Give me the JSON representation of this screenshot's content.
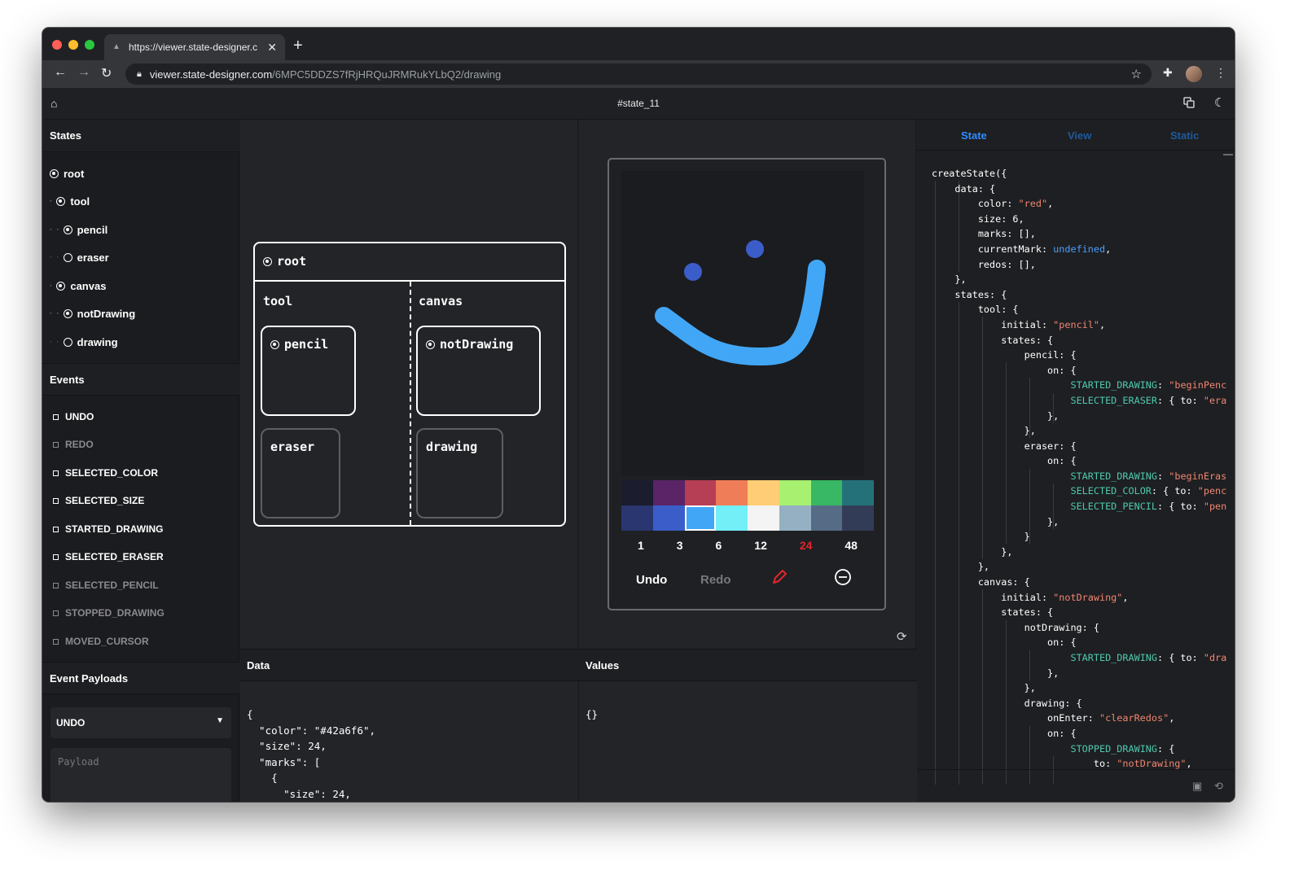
{
  "browser": {
    "tab_title": "https://viewer.state-designer.c",
    "url_host": "viewer.state-designer.com",
    "url_path": "/6MPC5DDZS7fRjHRQuJRMRukYLbQ2/drawing"
  },
  "app": {
    "title": "#state_11"
  },
  "states": {
    "header": "States",
    "items": [
      {
        "label": "root",
        "depth": 0,
        "active": true
      },
      {
        "label": "tool",
        "depth": 1,
        "active": true
      },
      {
        "label": "pencil",
        "depth": 2,
        "active": true
      },
      {
        "label": "eraser",
        "depth": 2,
        "active": false
      },
      {
        "label": "canvas",
        "depth": 1,
        "active": true
      },
      {
        "label": "notDrawing",
        "depth": 2,
        "active": true
      },
      {
        "label": "drawing",
        "depth": 2,
        "active": false
      }
    ]
  },
  "events": {
    "header": "Events",
    "items": [
      {
        "label": "UNDO",
        "enabled": true
      },
      {
        "label": "REDO",
        "enabled": false
      },
      {
        "label": "SELECTED_COLOR",
        "enabled": true
      },
      {
        "label": "SELECTED_SIZE",
        "enabled": true
      },
      {
        "label": "STARTED_DRAWING",
        "enabled": true
      },
      {
        "label": "SELECTED_ERASER",
        "enabled": true
      },
      {
        "label": "SELECTED_PENCIL",
        "enabled": false
      },
      {
        "label": "STOPPED_DRAWING",
        "enabled": false
      },
      {
        "label": "MOVED_CURSOR",
        "enabled": false
      }
    ]
  },
  "payloads": {
    "header": "Event Payloads",
    "selected_event": "UNDO",
    "placeholder": "Payload"
  },
  "chart": {
    "root": "root",
    "regions": [
      "tool",
      "canvas"
    ],
    "nodes": {
      "pencil": "pencil",
      "eraser": "eraser",
      "notDrawing": "notDrawing",
      "drawing": "drawing"
    }
  },
  "preview": {
    "palette": [
      "#1b1c2e",
      "#5a2466",
      "#b63e55",
      "#ef7d57",
      "#ffcd75",
      "#a7f070",
      "#38b764",
      "#257179",
      "#29366f",
      "#3b5dc9",
      "#42a6f6",
      "#73eff7",
      "#f4f4f4",
      "#94b0c2",
      "#566c86",
      "#333c57"
    ],
    "selected_color": "#42a6f6",
    "sizes": [
      "1",
      "3",
      "6",
      "12",
      "24",
      "48"
    ],
    "selected_size": "24",
    "undo_label": "Undo",
    "redo_label": "Redo",
    "accent_red": "#e0262c"
  },
  "data_pane": {
    "header": "Data",
    "content": "{\n  \"color\": \"#42a6f6\",\n  \"size\": 24,\n  \"marks\": [\n    {\n      \"size\": 24,"
  },
  "values_pane": {
    "header": "Values",
    "content": "{}"
  },
  "code_panel": {
    "tabs": [
      "State",
      "View",
      "Static"
    ],
    "active_tab": "State"
  }
}
